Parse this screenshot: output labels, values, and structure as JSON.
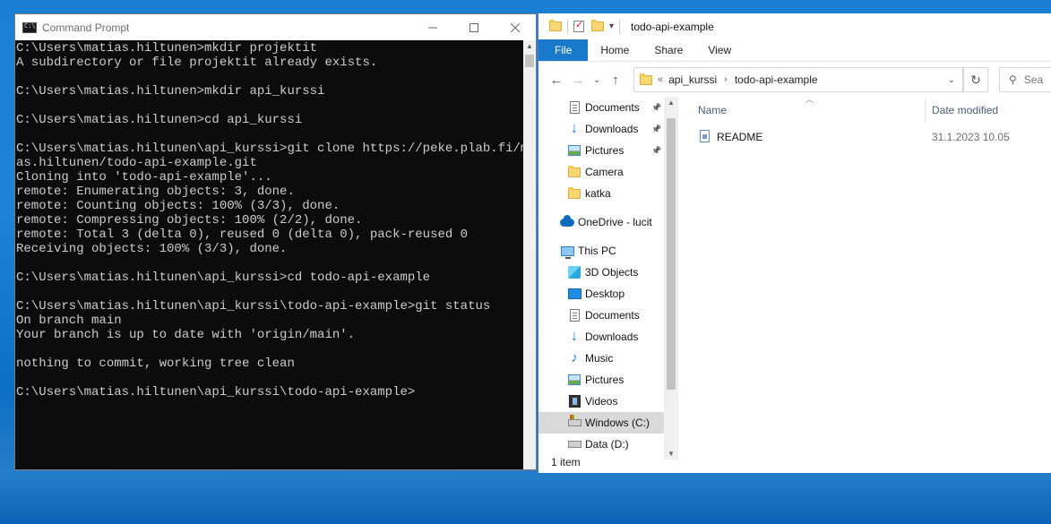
{
  "cmd": {
    "title": "Command Prompt",
    "lines": [
      "C:\\Users\\matias.hiltunen>mkdir projektit",
      "A subdirectory or file projektit already exists.",
      "",
      "C:\\Users\\matias.hiltunen>mkdir api_kurssi",
      "",
      "C:\\Users\\matias.hiltunen>cd api_kurssi",
      "",
      "C:\\Users\\matias.hiltunen\\api_kurssi>git clone https://peke.plab.fi/mati",
      "as.hiltunen/todo-api-example.git",
      "Cloning into 'todo-api-example'...",
      "remote: Enumerating objects: 3, done.",
      "remote: Counting objects: 100% (3/3), done.",
      "remote: Compressing objects: 100% (2/2), done.",
      "remote: Total 3 (delta 0), reused 0 (delta 0), pack-reused 0",
      "Receiving objects: 100% (3/3), done.",
      "",
      "C:\\Users\\matias.hiltunen\\api_kurssi>cd todo-api-example",
      "",
      "C:\\Users\\matias.hiltunen\\api_kurssi\\todo-api-example>git status",
      "On branch main",
      "Your branch is up to date with 'origin/main'.",
      "",
      "nothing to commit, working tree clean",
      "",
      "C:\\Users\\matias.hiltunen\\api_kurssi\\todo-api-example>"
    ]
  },
  "explorer": {
    "title": "todo-api-example",
    "tabs": [
      "File",
      "Home",
      "Share",
      "View"
    ],
    "breadcrumb": {
      "prefix": "«",
      "parts": [
        "api_kurssi",
        "todo-api-example"
      ]
    },
    "search_placeholder": "Sea",
    "nav_items": [
      {
        "label": "Documents",
        "icon": "documents-icon",
        "pinned": true
      },
      {
        "label": "Downloads",
        "icon": "downloads-icon",
        "pinned": true
      },
      {
        "label": "Pictures",
        "icon": "pictures-icon",
        "pinned": true
      },
      {
        "label": "Camera",
        "icon": "folder-icon",
        "pinned": false
      },
      {
        "label": "katka",
        "icon": "folder-icon",
        "pinned": false
      }
    ],
    "onedrive_label": "OneDrive - lucit",
    "thispc_label": "This PC",
    "pc_items": [
      {
        "label": "3D Objects",
        "icon": "3d-objects-icon"
      },
      {
        "label": "Desktop",
        "icon": "desktop-icon"
      },
      {
        "label": "Documents",
        "icon": "documents-icon"
      },
      {
        "label": "Downloads",
        "icon": "downloads-icon"
      },
      {
        "label": "Music",
        "icon": "music-icon"
      },
      {
        "label": "Pictures",
        "icon": "pictures-icon"
      },
      {
        "label": "Videos",
        "icon": "videos-icon"
      },
      {
        "label": "Windows (C:)",
        "icon": "windows-drive-icon"
      },
      {
        "label": "Data (D:)",
        "icon": "drive-icon"
      }
    ],
    "columns": {
      "name": "Name",
      "date": "Date modified"
    },
    "files": [
      {
        "name": "README",
        "date": "31.1.2023 10.05"
      }
    ],
    "status": "1 item"
  }
}
